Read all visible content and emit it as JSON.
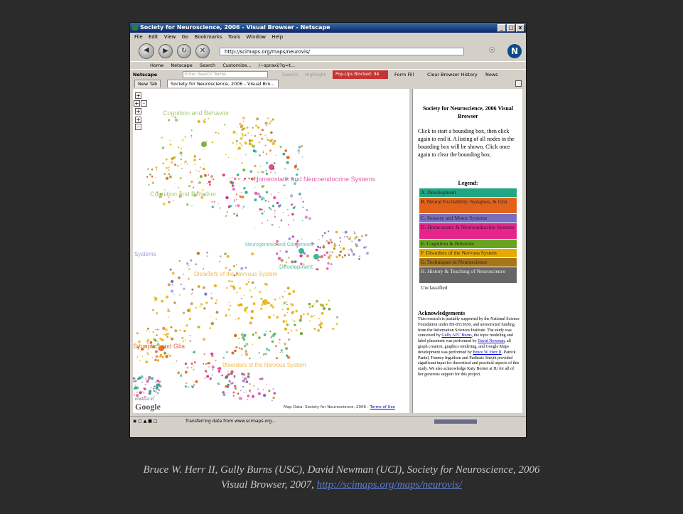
{
  "window": {
    "title": "Society for Neuroscience, 2006 - Visual Browser - Netscape",
    "controls": [
      "_",
      "□",
      "x"
    ]
  },
  "menu": [
    "File",
    "Edit",
    "View",
    "Go",
    "Bookmarks",
    "Tools",
    "Window",
    "Help"
  ],
  "navigation": {
    "url": "http://scimaps.org/maps/neurovis/",
    "logo_letter": "N"
  },
  "bookmarks": [
    "Home",
    "Netscape",
    "Search",
    "Customize...",
    "/~spraxi/?q=t..."
  ],
  "netscape_bar": {
    "label": "Netscape",
    "search_placeholder": "Enter Search Terms",
    "search_button": "Search",
    "highlight_button": "Highlight",
    "popup_blocked": "Pop-Ups Blocked: 94",
    "form_fill": "Form Fill",
    "clear_history": "Clear Browser History",
    "news": "News"
  },
  "tabs": [
    "New Tab",
    "Society for Neuroscience, 2006 - Visual Bro..."
  ],
  "map": {
    "zoom_controls": [
      "+",
      "+",
      "-",
      "+",
      "+",
      "-"
    ],
    "labels": [
      {
        "text": "Cognition and Behavior",
        "color": "#a8c878"
      },
      {
        "text": "Homeostatic and Neuroendocrine Systems",
        "color": "#e060b0"
      },
      {
        "text": "Cognition and Behavior",
        "color": "#a8c878"
      },
      {
        "text": "Neurogenesis and Gliogenesis",
        "color": "#66c2a5"
      },
      {
        "text": "Development",
        "color": "#66c2a5"
      },
      {
        "text": "Disorders of the Nervous System",
        "color": "#f0b850"
      },
      {
        "text": "Systems",
        "color": "#9aa0d8"
      },
      {
        "text": "Synaptic, and Glia",
        "color": "#e07030"
      },
      {
        "text": "Disorders of the Nervous System",
        "color": "#f0b850"
      }
    ],
    "powered_by": "POWERED BY",
    "google": "Google",
    "map_data": "Map Data: Society for Neuroscience, 2006 -",
    "terms_link": "Terms of Use"
  },
  "sidebar": {
    "title": "Society for Neuroscience, 2006 Visual Browser",
    "instructions": "Click to start a bounding box, then click again to end it. A listing of all nodes in the bounding box will be shown. Click once again to clear the bounding box.",
    "legend_title": "Legend:",
    "legend": [
      {
        "label": "A. Development",
        "color": "#1ea782"
      },
      {
        "label": "B. Neural Excitability, Synapses, & Glia",
        "color": "#e2621b"
      },
      {
        "label": "C. Sensory and Motor Systems",
        "color": "#7a6fbe"
      },
      {
        "label": "D. Homeostatic & Neuroendocrine Systems",
        "color": "#e6258c"
      },
      {
        "label": "E. Cognition & Behavior",
        "color": "#66a61e"
      },
      {
        "label": "F. Disorders of the Nervous System",
        "color": "#e6ab02"
      },
      {
        "label": "G. Techniques in Neuroscience",
        "color": "#a6761d"
      },
      {
        "label": "H. History & Teaching of Neuroscience",
        "color": "#666666"
      },
      {
        "label": "Unclassified",
        "color": "#ffffff"
      }
    ],
    "ack_title": "Acknowledgements",
    "ack_1": "This research is partially supported by the National Science Foundation under IIS-0513650, and unrestricted funding from the Information Sciences Institute. The study was conceived by ",
    "ack_link_1": "Gully APC Burns",
    "ack_2": ", the topic modeling and label placement was performed by ",
    "ack_link_2": "David Newman",
    "ack_3": ", all graph creation, graphics rendering, and Google Maps development was performed by ",
    "ack_link_3": "Bruce W. Herr II",
    "ack_4": ". Patrick Pantel, Tommy Ingulfsen and Padhraic Smyth provided significant input for theoretical and practical aspects of this study. We also acknowledge Katy Borner at IU for all of her generous support for this project."
  },
  "status": "Transferring data from www.scimaps.org...",
  "caption": {
    "line1": "Bruce W. Herr II, Gully Burns (USC), David Newman (UCI), Society for Neuroscience, 2006",
    "line2": "Visual Browser, 2007, ",
    "link": "http://scimaps.org/maps/neurovis/"
  }
}
